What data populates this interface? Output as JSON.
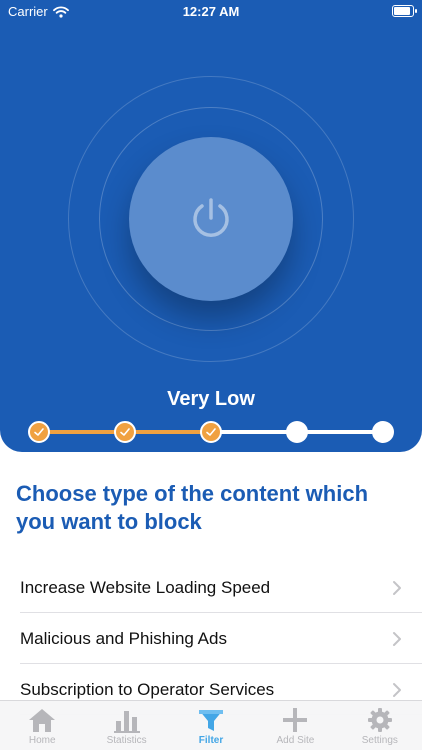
{
  "status_bar": {
    "carrier": "Carrier",
    "time": "12:27 AM"
  },
  "hero": {
    "level_label": "Very Low",
    "slider": {
      "total_steps": 5,
      "active_steps": 3
    }
  },
  "heading": "Choose type of the content which you want to block",
  "list_items": [
    {
      "label": "Increase Website Loading Speed"
    },
    {
      "label": "Malicious and Phishing Ads"
    },
    {
      "label": "Subscription to Operator Services"
    }
  ],
  "tabs": [
    {
      "label": "Home",
      "icon": "home-icon",
      "active": false
    },
    {
      "label": "Statistics",
      "icon": "bar-chart-icon",
      "active": false
    },
    {
      "label": "Filter",
      "icon": "filter-icon",
      "active": true
    },
    {
      "label": "Add Site",
      "icon": "plus-icon",
      "active": false
    },
    {
      "label": "Settings",
      "icon": "gear-icon",
      "active": false
    }
  ],
  "colors": {
    "primary": "#1b5cb4",
    "accent": "#f0a141",
    "tab_active": "#43a6e6",
    "tab_inactive": "#b6b6ba"
  }
}
